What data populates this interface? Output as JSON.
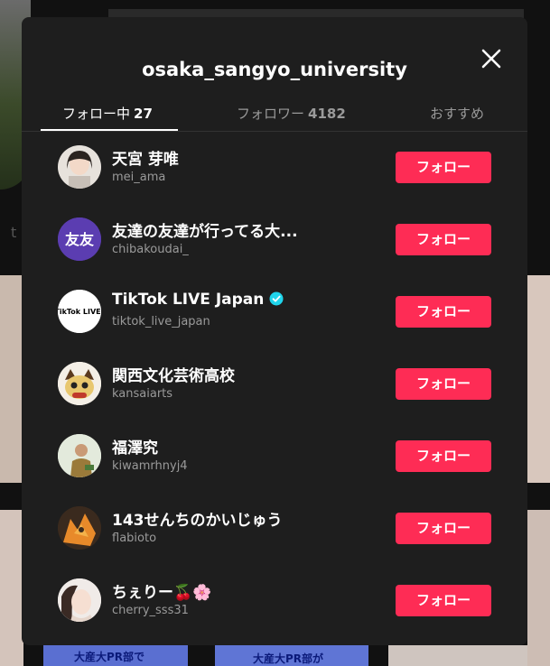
{
  "modal": {
    "title": "osaka_sangyo_university",
    "tabs": [
      {
        "label": "フォロー中",
        "count": "27"
      },
      {
        "label": "フォロワー",
        "count": "4182"
      },
      {
        "label": "おすすめ",
        "count": ""
      }
    ]
  },
  "accounts": [
    {
      "name": "天宮 芽唯",
      "handle": "mei_ama",
      "button": "フォロー",
      "avatar": "portrait-woman-photo"
    },
    {
      "name": "友達の友達が行ってる大...",
      "handle": "chibakoudai_",
      "button": "フォロー",
      "avatar": "text-logo",
      "avatar_text": "友友"
    },
    {
      "name": "TikTok LIVE Japan",
      "handle": "tiktok_live_japan",
      "button": "フォロー",
      "avatar": "tiktok-live-logo",
      "avatar_text": "TikTok LIVE",
      "verified": true
    },
    {
      "name": "関西文化芸術高校",
      "handle": "kansaiarts",
      "button": "フォロー",
      "avatar": "mascot-illustration"
    },
    {
      "name": "福澤究",
      "handle": "kiwamrhnyj4",
      "button": "フォロー",
      "avatar": "portrait-man-photo"
    },
    {
      "name": "143せんちのかいじゅう",
      "handle": "flabioto",
      "button": "フォロー",
      "avatar": "costume-photo"
    },
    {
      "name": "ちぇりー🍒🌸",
      "handle": "cherry_sss31",
      "button": "フォロー",
      "avatar": "portrait-woman-photo"
    }
  ],
  "background": {
    "side_letter": "t",
    "tile_label_1": "大産大PR部で",
    "tile_label_2": "大産大PR部が"
  },
  "colors": {
    "accent": "#fe2c55",
    "modal_bg": "#1e1e1e",
    "verified": "#20d5ec"
  }
}
